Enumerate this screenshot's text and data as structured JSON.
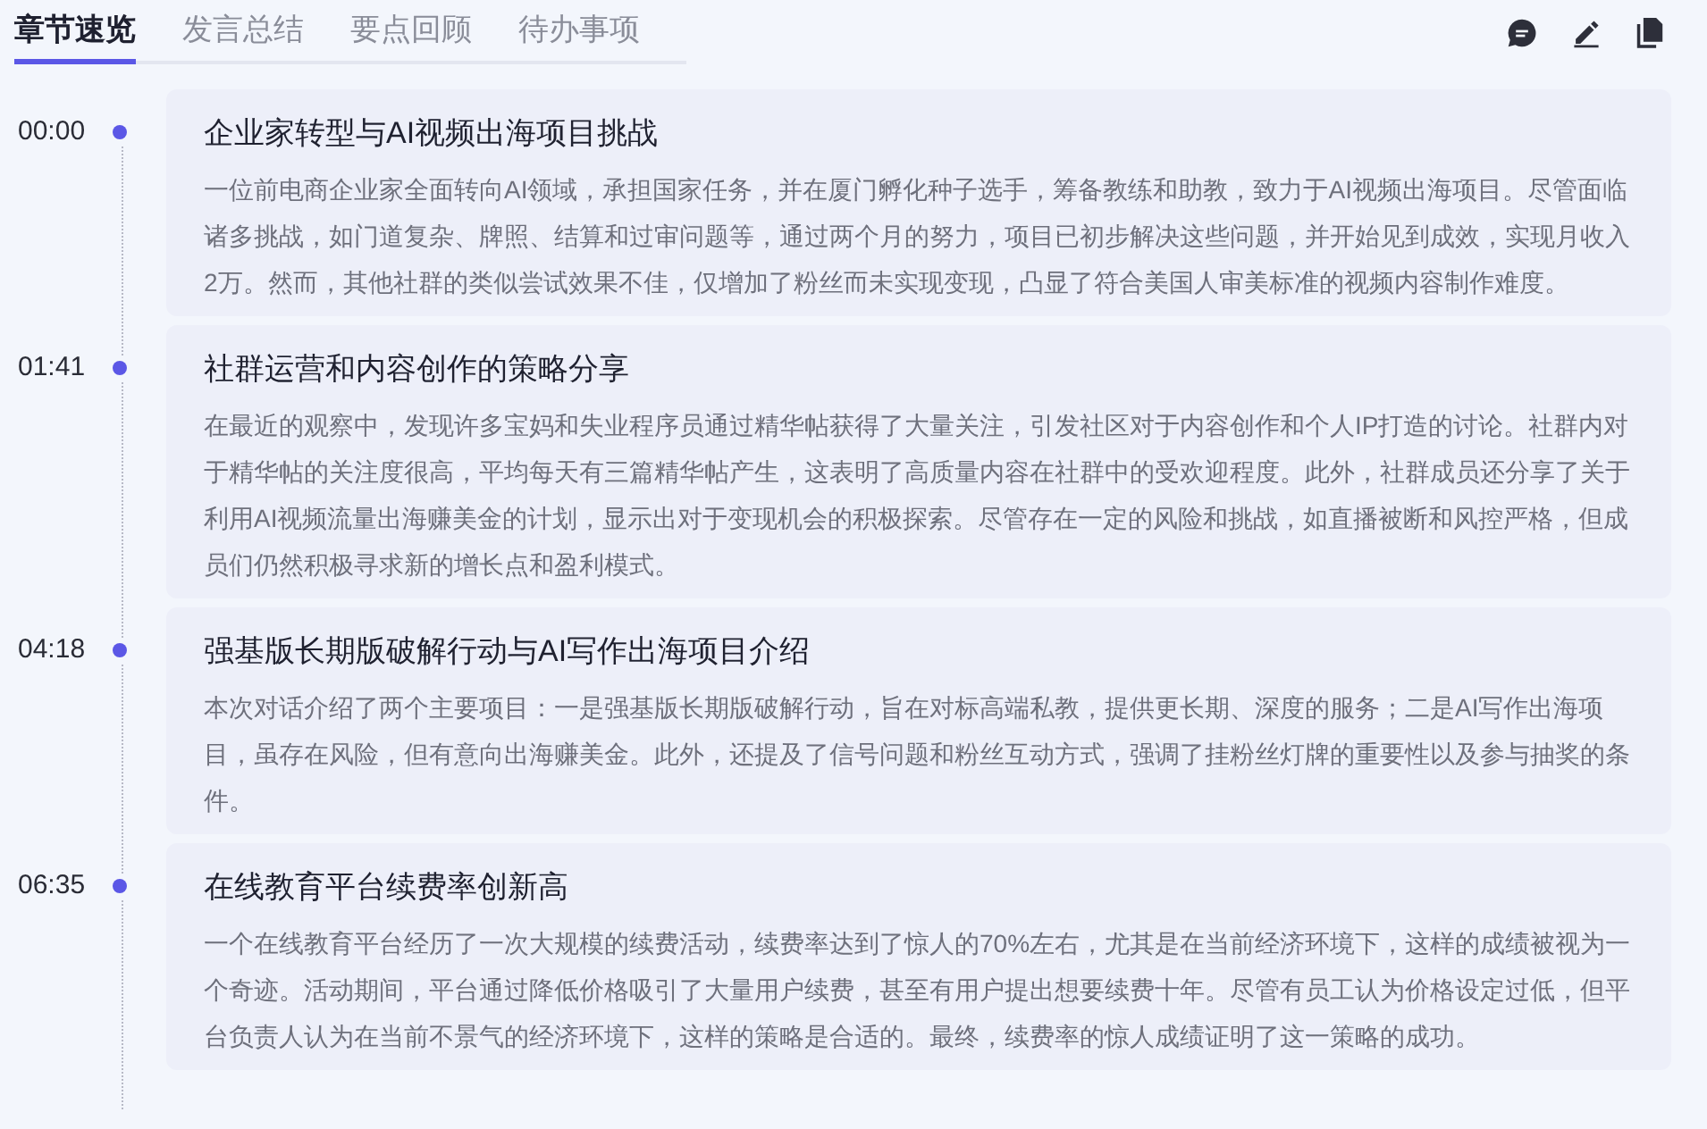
{
  "tabs": [
    {
      "label": "章节速览",
      "selected": true
    },
    {
      "label": "发言总结",
      "selected": false
    },
    {
      "label": "要点回顾",
      "selected": false
    },
    {
      "label": "待办事项",
      "selected": false
    }
  ],
  "chapters": [
    {
      "time": "00:00",
      "title": "企业家转型与AI视频出海项目挑战",
      "summary": "一位前电商企业家全面转向AI领域，承担国家任务，并在厦门孵化种子选手，筹备教练和助教，致力于AI视频出海项目。尽管面临诸多挑战，如门道复杂、牌照、结算和过审问题等，通过两个月的努力，项目已初步解决这些问题，并开始见到成效，实现月收入2万。然而，其他社群的类似尝试效果不佳，仅增加了粉丝而未实现变现，凸显了符合美国人审美标准的视频内容制作难度。"
    },
    {
      "time": "01:41",
      "title": "社群运营和内容创作的策略分享",
      "summary": "在最近的观察中，发现许多宝妈和失业程序员通过精华帖获得了大量关注，引发社区对于内容创作和个人IP打造的讨论。社群内对于精华帖的关注度很高，平均每天有三篇精华帖产生，这表明了高质量内容在社群中的受欢迎程度。此外，社群成员还分享了关于利用AI视频流量出海赚美金的计划，显示出对于变现机会的积极探索。尽管存在一定的风险和挑战，如直播被断和风控严格，但成员们仍然积极寻求新的增长点和盈利模式。"
    },
    {
      "time": "04:18",
      "title": "强基版长期版破解行动与AI写作出海项目介绍",
      "summary": "本次对话介绍了两个主要项目：一是强基版长期版破解行动，旨在对标高端私教，提供更长期、深度的服务；二是AI写作出海项目，虽存在风险，但有意向出海赚美金。此外，还提及了信号问题和粉丝互动方式，强调了挂粉丝灯牌的重要性以及参与抽奖的条件。"
    },
    {
      "time": "06:35",
      "title": "在线教育平台续费率创新高",
      "summary": "一个在线教育平台经历了一次大规模的续费活动，续费率达到了惊人的70%左右，尤其是在当前经济环境下，这样的成绩被视为一个奇迹。活动期间，平台通过降低价格吸引了大量用户续费，甚至有用户提出想要续费十年。尽管有员工认为价格设定过低，但平台负责人认为在当前不景气的经济环境下，这样的策略是合适的。最终，续费率的惊人成绩证明了这一策略的成功。"
    }
  ]
}
